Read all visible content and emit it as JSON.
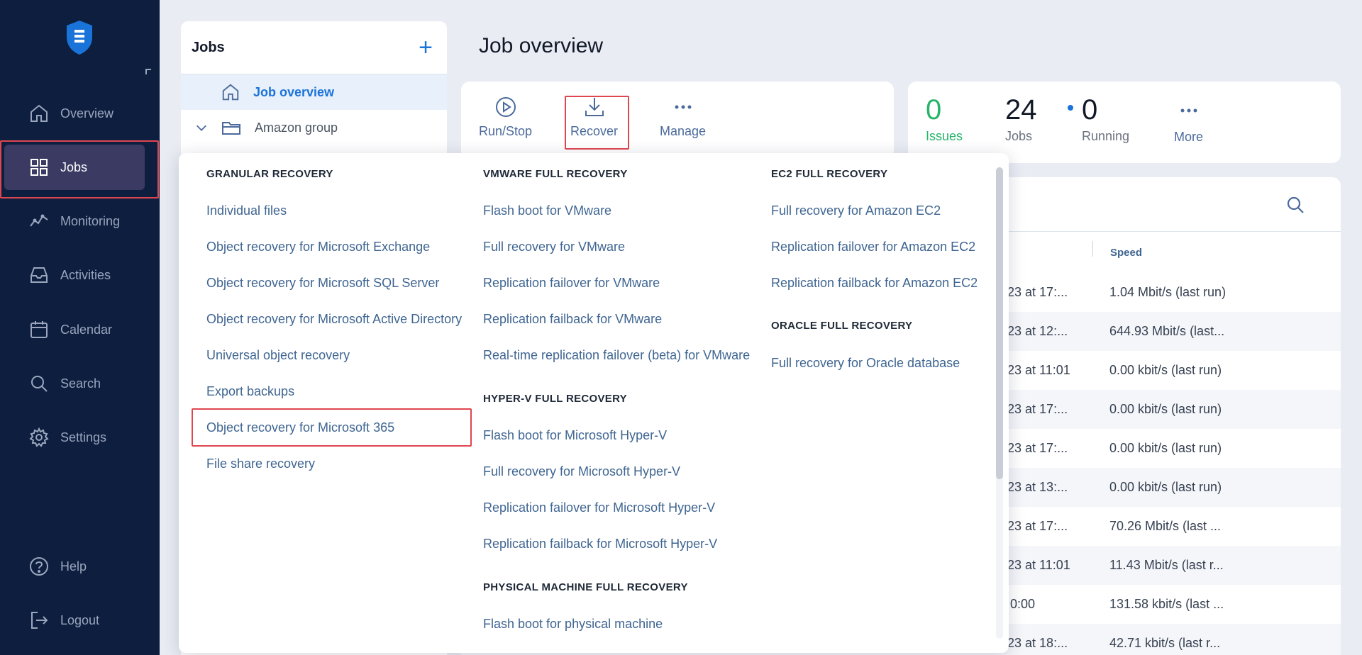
{
  "sidebar": {
    "items": [
      {
        "label": "Overview",
        "icon": "home-icon"
      },
      {
        "label": "Jobs",
        "icon": "grid-icon"
      },
      {
        "label": "Monitoring",
        "icon": "pulse-icon"
      },
      {
        "label": "Activities",
        "icon": "inbox-icon"
      },
      {
        "label": "Calendar",
        "icon": "calendar-icon"
      },
      {
        "label": "Search",
        "icon": "search-icon"
      },
      {
        "label": "Settings",
        "icon": "gear-icon"
      }
    ],
    "bottom": [
      {
        "label": "Help",
        "icon": "help-icon"
      },
      {
        "label": "Logout",
        "icon": "logout-icon"
      }
    ]
  },
  "jobs_panel": {
    "title": "Jobs",
    "rows": [
      {
        "label": "Job overview"
      },
      {
        "label": "Amazon group"
      }
    ]
  },
  "header": {
    "title": "Job overview"
  },
  "toolbar": {
    "run_stop": "Run/Stop",
    "recover": "Recover",
    "manage": "Manage"
  },
  "stats": {
    "issues_value": "0",
    "issues_label": "Issues",
    "jobs_value": "24",
    "jobs_label": "Jobs",
    "running_value": "0",
    "running_label": "Running",
    "more_label": "More"
  },
  "table": {
    "speed_header": "Speed",
    "rows": [
      {
        "c1": "023 at 17:...",
        "c2": "1.04 Mbit/s (last run)"
      },
      {
        "c1": "023 at 12:...",
        "c2": "644.93 Mbit/s (last..."
      },
      {
        "c1": "023 at 11:01",
        "c2": "0.00 kbit/s (last run)"
      },
      {
        "c1": "023 at 17:...",
        "c2": "0.00 kbit/s (last run)"
      },
      {
        "c1": "023 at 17:...",
        "c2": "0.00 kbit/s (last run)"
      },
      {
        "c1": "023 at 13:...",
        "c2": "0.00 kbit/s (last run)"
      },
      {
        "c1": "023 at 17:...",
        "c2": "70.26 Mbit/s (last ..."
      },
      {
        "c1": "023 at 11:01",
        "c2": "11.43 Mbit/s (last r..."
      },
      {
        "c1": "0:00",
        "c2": "131.58 kbit/s (last ..."
      },
      {
        "c1": "023 at 18:...",
        "c2": "42.71 kbit/s (last r..."
      }
    ]
  },
  "recover_menu": {
    "granular": {
      "title": "GRANULAR RECOVERY",
      "items": [
        "Individual files",
        "Object recovery for Microsoft Exchange",
        "Object recovery for Microsoft SQL Server",
        "Object recovery for Microsoft Active Directory",
        "Universal object recovery",
        "Export backups",
        "Object recovery for Microsoft 365",
        "File share recovery"
      ]
    },
    "vmware": {
      "title": "VMWARE FULL RECOVERY",
      "items": [
        "Flash boot for VMware",
        "Full recovery for VMware",
        "Replication failover for VMware",
        "Replication failback for VMware",
        "Real-time replication failover (beta) for VMware"
      ]
    },
    "hyperv": {
      "title": "HYPER-V FULL RECOVERY",
      "items": [
        "Flash boot for Microsoft Hyper-V",
        "Full recovery for Microsoft Hyper-V",
        "Replication failover for Microsoft Hyper-V",
        "Replication failback for Microsoft Hyper-V"
      ]
    },
    "physical": {
      "title": "PHYSICAL MACHINE FULL RECOVERY",
      "items": [
        "Flash boot for physical machine"
      ]
    },
    "ec2": {
      "title": "EC2 FULL RECOVERY",
      "items": [
        "Full recovery for Amazon EC2",
        "Replication failover for Amazon EC2",
        "Replication failback for Amazon EC2"
      ]
    },
    "oracle": {
      "title": "ORACLE FULL RECOVERY",
      "items": [
        "Full recovery for Oracle database"
      ]
    }
  },
  "colors": {
    "sidebar_bg": "#0e1e3f",
    "accent": "#1a73d9",
    "success": "#27b46a",
    "link": "#3f6591",
    "highlight": "#e0464f"
  }
}
